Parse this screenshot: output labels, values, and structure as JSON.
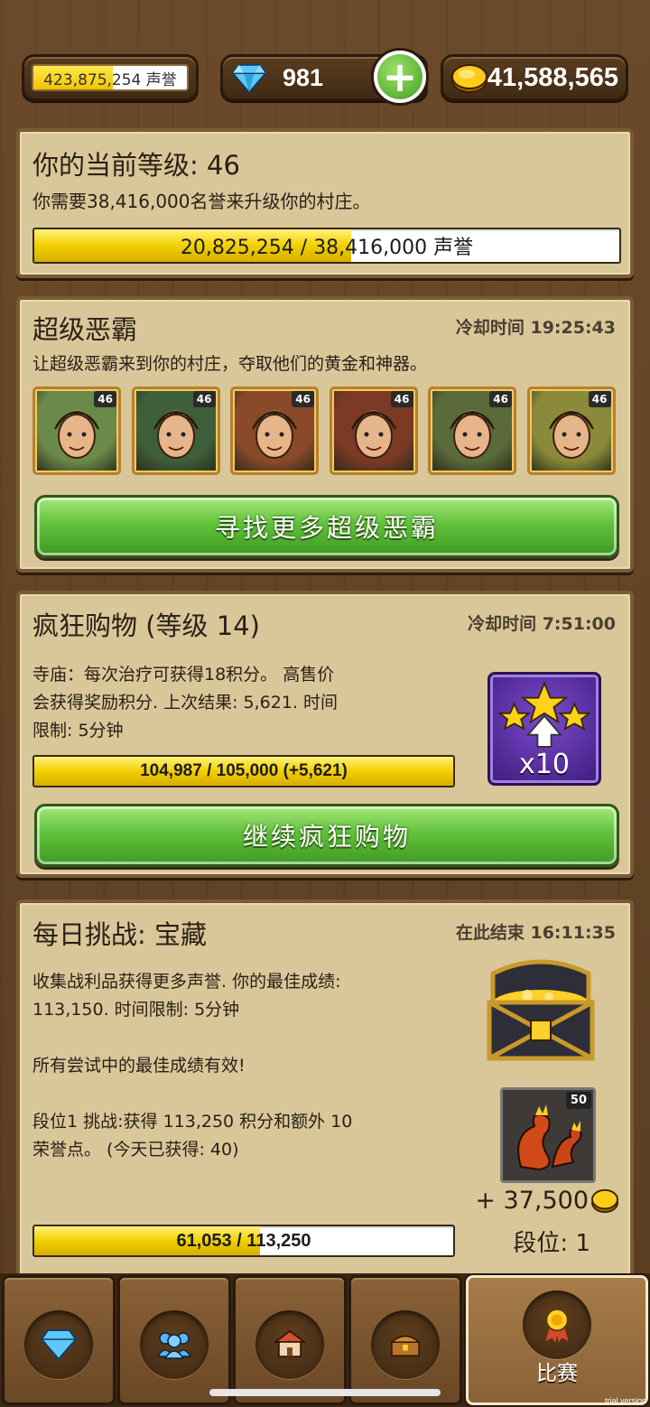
{
  "top_bar": {
    "reputation_text": "423,875,254 声誉",
    "reputation_fill": 0.52,
    "gems": "981",
    "gold": "41,588,565"
  },
  "level_panel": {
    "title": "你的当前等级: 46",
    "subtitle": "你需要38,416,000名誉来升级你的村庄。",
    "progress_text": "20,825,254 / 38,416,000 声誉",
    "progress_fill": 0.542
  },
  "bully_panel": {
    "title": "超级恶霸",
    "cooldown": "冷却时间 19:25:43",
    "description": "让超级恶霸来到你的村庄，夺取他们的黄金和神器。",
    "heroes": [
      {
        "level": "46",
        "color": "#6a8a4a"
      },
      {
        "level": "46",
        "color": "#3e5f3a"
      },
      {
        "level": "46",
        "color": "#8a4a2a"
      },
      {
        "level": "46",
        "color": "#7a3a24"
      },
      {
        "level": "46",
        "color": "#5a6a3a"
      },
      {
        "level": "46",
        "color": "#8a8a3a"
      }
    ],
    "button": "寻找更多超级恶霸"
  },
  "shopping_panel": {
    "title": "疯狂购物 (等级 14)",
    "cooldown": "冷却时间 7:51:00",
    "description_lines": [
      "寺庙：每次治疗可获得18积分。 高售价",
      "会获得奖励积分. 上次结果: 5,621. 时间",
      "限制: 5分钟"
    ],
    "progress_text": "104,987 / 105,000 (+5,621)",
    "progress_fill": 0.9999,
    "multiplier": "x10",
    "button": "继续疯狂购物"
  },
  "challenge_panel": {
    "title": "每日挑战: 宝藏",
    "ends": "在此结束 16:11:35",
    "lines": [
      "收集战利品获得更多声誉. 你的最佳成绩:",
      "113,150. 时间限制: 5分钟",
      "",
      "所有尝试中的最佳成绩有效!",
      "",
      "段位1 挑战:获得 113,250 积分和额外 10",
      "荣誉点。 (今天已获得: 40)"
    ],
    "reward_badge": "50",
    "reward_gold": "+ 37,500",
    "rank": "段位: 1",
    "progress_text": "61,053 / 113,250",
    "progress_fill": 0.539
  },
  "bottom_nav": {
    "tabs": [
      {
        "name": "diamond-icon",
        "label": ""
      },
      {
        "name": "people-icon",
        "label": ""
      },
      {
        "name": "village-icon",
        "label": ""
      },
      {
        "name": "chest-icon",
        "label": ""
      },
      {
        "name": "medal-icon",
        "label": "比赛"
      }
    ]
  },
  "watermark": "trial version"
}
